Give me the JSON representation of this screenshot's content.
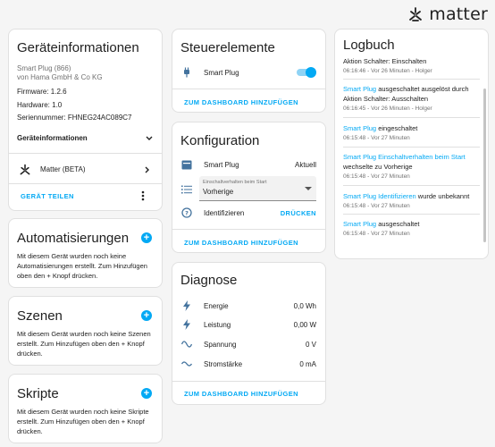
{
  "brand": {
    "name": "matter"
  },
  "device_info": {
    "title": "Geräteinformationen",
    "model": "Smart Plug (866)",
    "manufacturer": "von Hama GmbH & Co KG",
    "firmware": "Firmware: 1.2.6",
    "hardware": "Hardware: 1.0",
    "serial": "Seriennummer: FHNEG24AC089C7",
    "expander_label": "Geräteinformationen",
    "integration_label": "Matter (BETA)",
    "share_button": "GERÄT TEILEN"
  },
  "automations": {
    "title": "Automatisierungen",
    "description": "Mit diesem Gerät wurden noch keine Automatisierungen erstellt. Zum Hinzufügen oben den + Knopf drücken."
  },
  "scenes": {
    "title": "Szenen",
    "description": "Mit diesem Gerät wurden noch keine Szenen erstellt. Zum Hinzufügen oben den + Knopf drücken."
  },
  "scripts": {
    "title": "Skripte",
    "description": "Mit diesem Gerät wurden noch keine Skripte erstellt. Zum Hinzufügen oben den + Knopf drücken."
  },
  "controls": {
    "title": "Steuerelemente",
    "switch_label": "Smart Plug",
    "switch_on": true,
    "add_button": "ZUM DASHBOARD HINZUFÜGEN"
  },
  "configuration": {
    "title": "Konfiguration",
    "firmware_label": "Smart Plug",
    "firmware_state": "Aktuell",
    "select_label": "Einschaltverhalten beim Start",
    "select_value": "Vorherige",
    "identify_label": "Identifizieren",
    "identify_button": "DRÜCKEN",
    "add_button": "ZUM DASHBOARD HINZUFÜGEN"
  },
  "diagnostics": {
    "title": "Diagnose",
    "rows": [
      {
        "label": "Energie",
        "value": "0,0 Wh"
      },
      {
        "label": "Leistung",
        "value": "0,00 W"
      },
      {
        "label": "Spannung",
        "value": "0 V"
      },
      {
        "label": "Stromstärke",
        "value": "0 mA"
      }
    ],
    "add_button": "ZUM DASHBOARD HINZUFÜGEN"
  },
  "logbook": {
    "title": "Logbuch",
    "entries": [
      {
        "line1": "Aktion Schalter: Einschalten",
        "time": "06:16:46 - Vor 26 Minuten - Holger"
      },
      {
        "link": "Smart Plug",
        "rest": " ausgeschaltet ausgelöst durch Aktion Schalter: Ausschalten",
        "time": "06:16:45 - Vor 26 Minuten - Holger"
      },
      {
        "link": "Smart Plug",
        "rest": " eingeschaltet",
        "time": "06:15:48 - Vor 27 Minuten"
      },
      {
        "link": "Smart Plug Einschaltverhalten beim Start",
        "rest": " wechselte zu Vorherige",
        "time": "06:15:48 - Vor 27 Minuten"
      },
      {
        "link": "Smart Plug Identifizieren",
        "rest": " wurde unbekannt",
        "time": "06:15:48 - Vor 27 Minuten"
      },
      {
        "link": "Smart Plug",
        "rest": " ausgeschaltet",
        "time": "06:15:48 - Vor 27 Minuten"
      }
    ]
  }
}
